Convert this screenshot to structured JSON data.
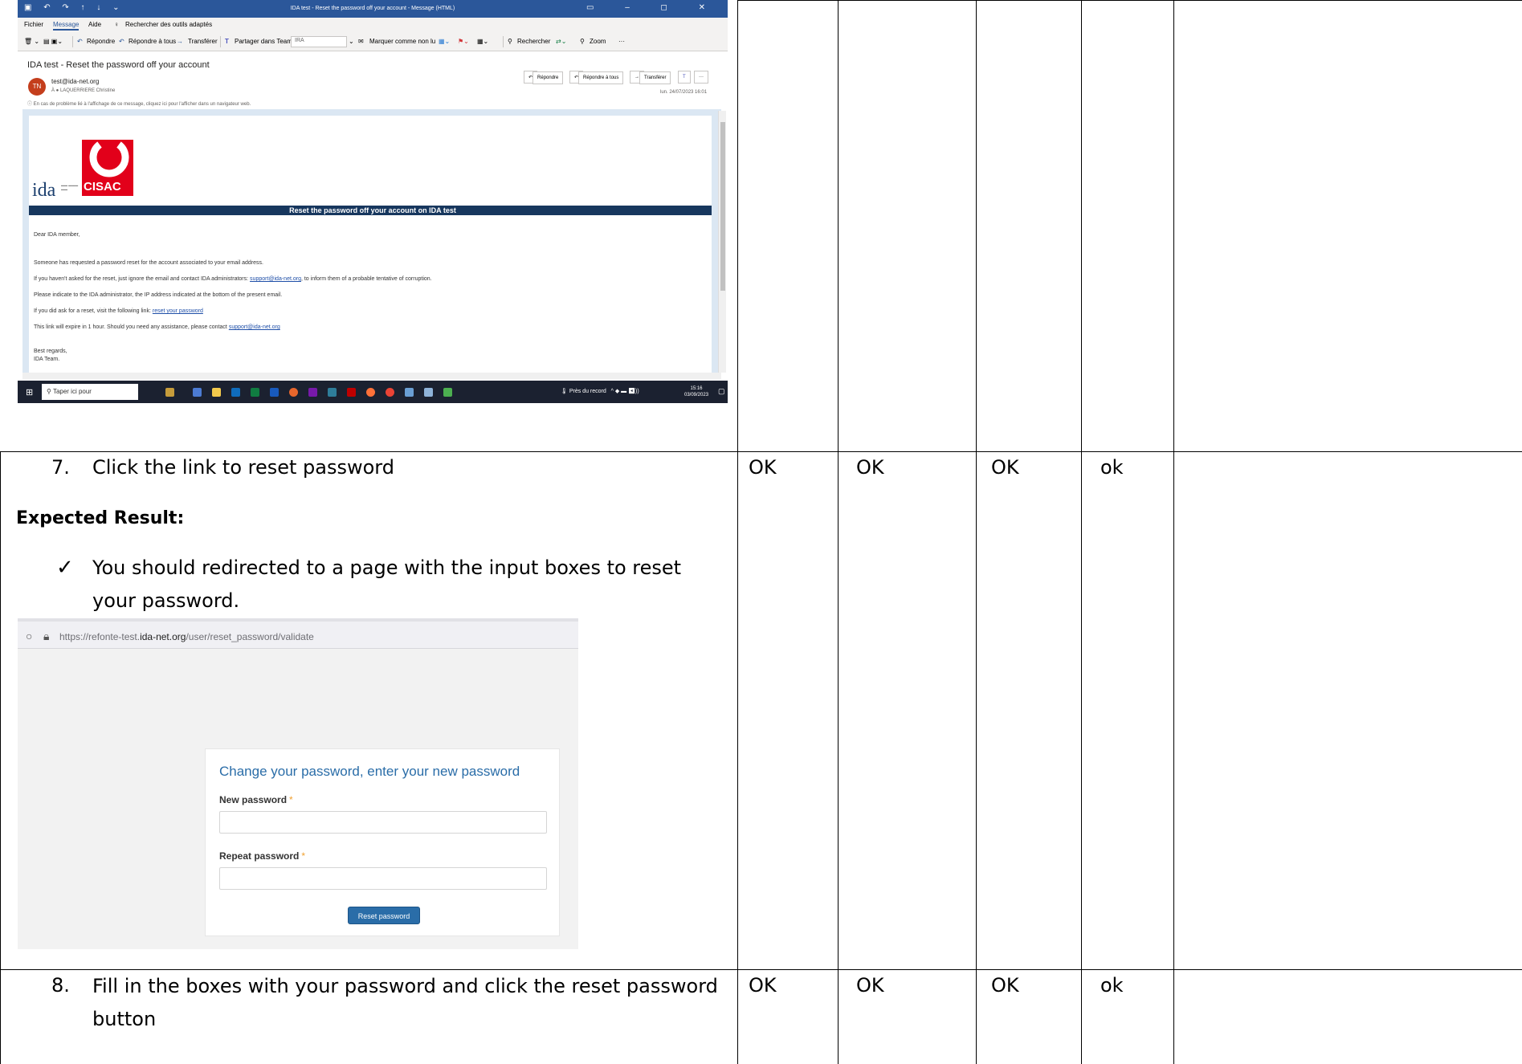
{
  "table": {
    "rows": [
      {
        "step_number": "7.",
        "step_text": "Click the link to reset password",
        "expected_label": "Expected Result:",
        "expected_text": "You should redirected to a page with the input boxes to reset your password.",
        "expected_line1": "You should redirected to a page with the input boxes to reset",
        "expected_line2": "your password.",
        "results": [
          "OK",
          "OK",
          "OK",
          "ok"
        ]
      },
      {
        "step_number": "8.",
        "step_text_line1": "Fill in the boxes with your password and click the reset password",
        "step_text_line2": "button",
        "results": [
          "OK",
          "OK",
          "OK",
          "ok"
        ]
      }
    ]
  },
  "outlook": {
    "window_title": "IDA test - Reset the password off your account  -  Message (HTML)",
    "menu": [
      "Fichier",
      "Message",
      "Aide"
    ],
    "menu_search": "Rechercher des outils adaptés",
    "ribbon": {
      "reply": "Répondre",
      "reply_all": "Répondre à tous",
      "forward": "Transférer",
      "share_teams": "Partager dans Teams",
      "dropdown": "IRA",
      "mark_unread": "Marquer comme non lu",
      "search": "Rechercher",
      "zoom": "Zoom"
    },
    "subject": "IDA test - Reset the password off your account",
    "avatar_initials": "TN",
    "from": "test@ida-net.org",
    "to": "À  ● LAQUERRIERE Christine",
    "info_bar": "En cas de problème lié à l'affichage de ce message, cliquez ici pour l'afficher dans un navigateur web.",
    "actions": [
      "Répondre",
      "Répondre à tous",
      "Transférer"
    ],
    "date": "lun. 24/07/2023 16:01",
    "email": {
      "logo_ida": "ida",
      "logo_cisac": "CISAC",
      "banner": "Reset the password off your account on IDA test",
      "greeting": "Dear IDA member,",
      "p1": "Someone has requested a password reset for the account associated to your email address.",
      "p2_before": "If you haven't asked for the reset, just ignore the email and contact IDA administrators: ",
      "p2_link": "support@ida-net.org",
      "p2_after": ", to inform them of a probable tentative of corruption.",
      "p3": "Please indicate to the IDA administrator, the IP address indicated at the bottom of the present email.",
      "p4_before": "If you did ask for a reset, visit the following link: ",
      "p4_link": "reset your password",
      "p5_before": "This link will expire in 1 hour. Should you need any assistance, please contact ",
      "p5_link": "support@ida-net.org",
      "sign1": "Best regards,",
      "sign2": "IDA Team."
    },
    "taskbar": {
      "search": "Taper ici pour",
      "weather": "Près du record",
      "time": "15:16",
      "date": "03/09/2023"
    }
  },
  "browser": {
    "url_prefix": "https://refonte-test.",
    "url_domain": "ida-net.org",
    "url_path": "/user/reset_password/validate",
    "heading": "Change your password, enter your new password",
    "new_password_label": "New password",
    "repeat_password_label": "Repeat password",
    "required_mark": "*",
    "button": "Reset password"
  }
}
